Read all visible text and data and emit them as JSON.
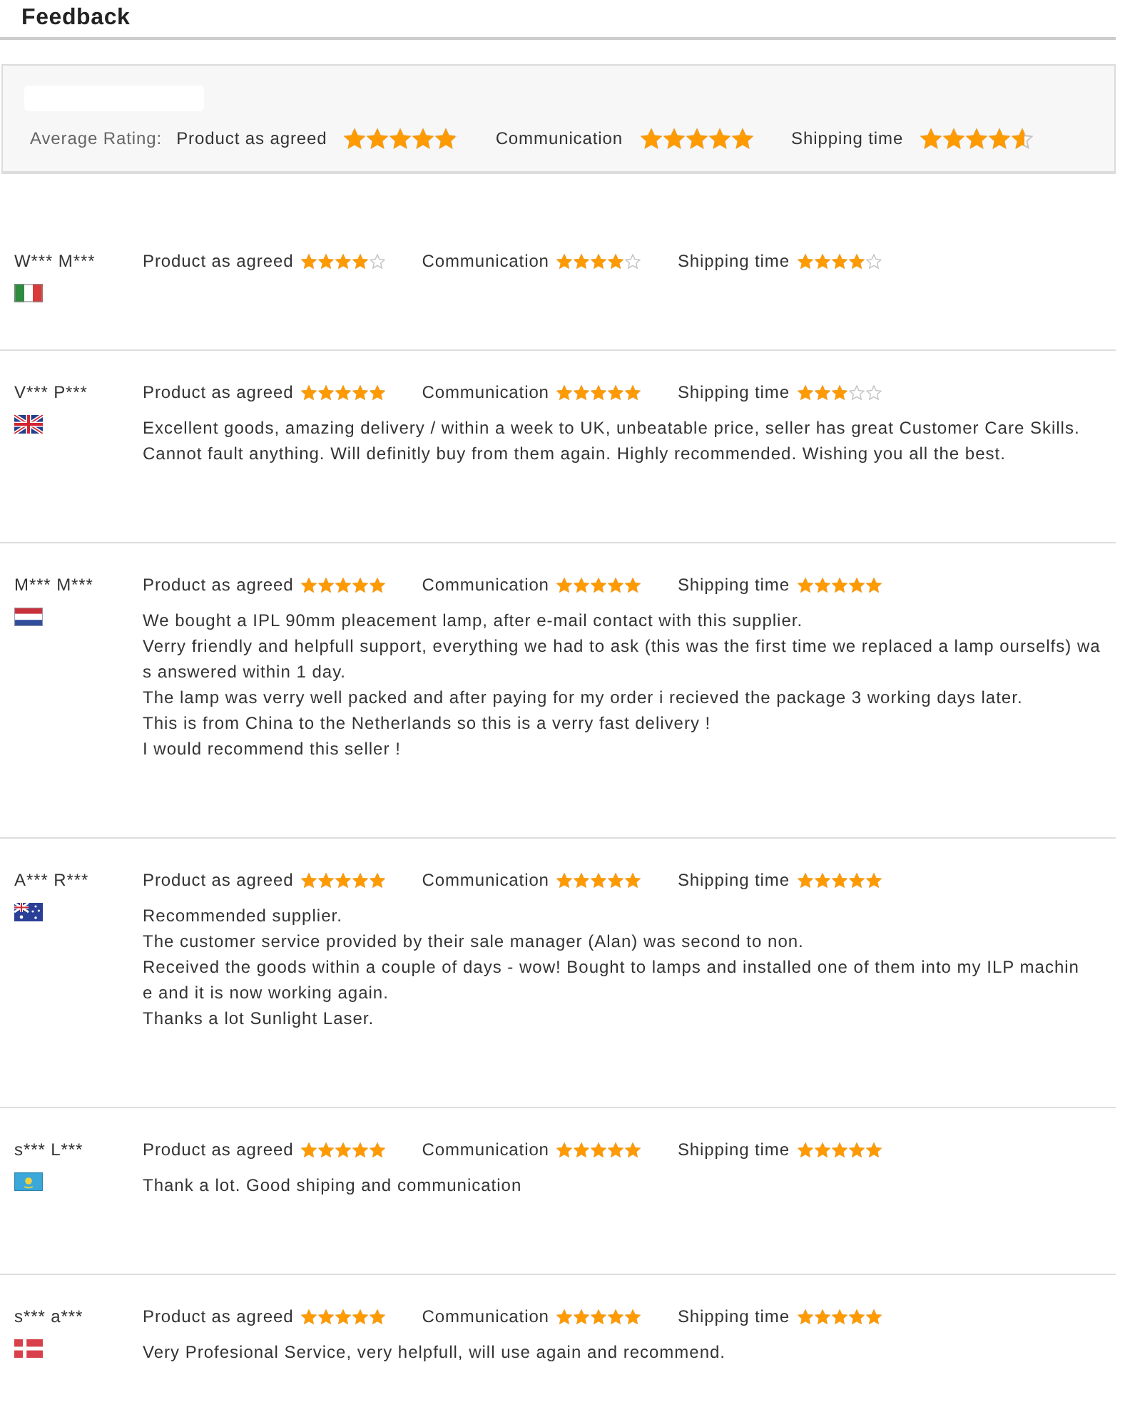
{
  "header": {
    "title": "Feedback"
  },
  "summary": {
    "label": "Average Rating:",
    "ratings": [
      {
        "label": "Product as agreed",
        "stars": 4.9
      },
      {
        "label": "Communication",
        "stars": 5
      },
      {
        "label": "Shipping time",
        "stars": 4.6
      }
    ]
  },
  "reviews": [
    {
      "name": "W*** M***",
      "flag": {
        "kind": "italy"
      },
      "ratings": [
        {
          "label": "Product as agreed",
          "stars": 4
        },
        {
          "label": "Communication",
          "stars": 4
        },
        {
          "label": "Shipping time",
          "stars": 4
        }
      ]
    },
    {
      "name": "V*** P***",
      "flag": {
        "kind": "uk"
      },
      "ratings": [
        {
          "label": "Product as agreed",
          "stars": 5
        },
        {
          "label": "Communication",
          "stars": 5
        },
        {
          "label": "Shipping time",
          "stars": 3
        }
      ],
      "comment": "Excellent goods, amazing delivery / within a week to UK, unbeatable price, seller has great Customer Care Skills.\nCannot fault anything. Will definitly buy from them again. Highly recommended. Wishing you all the best."
    },
    {
      "name": "M*** M***",
      "flag": {
        "kind": "netherlands"
      },
      "ratings": [
        {
          "label": "Product as agreed",
          "stars": 5
        },
        {
          "label": "Communication",
          "stars": 5
        },
        {
          "label": "Shipping time",
          "stars": 5
        }
      ],
      "comment": "We bought a IPL 90mm pleacement lamp, after e-mail contact with this supplier.\nVerry friendly and helpfull support, everything we had to ask (this was the first time we replaced a lamp ourselfs) wa\ns answered within 1 day.\nThe lamp was verry well packed and after paying for my order i recieved the package 3 working days later.\nThis is from China to the Netherlands so this is a verry fast delivery !\nI would recommend this seller !"
    },
    {
      "name": "A*** R***",
      "flag": {
        "kind": "australia"
      },
      "ratings": [
        {
          "label": "Product as agreed",
          "stars": 5
        },
        {
          "label": "Communication",
          "stars": 5
        },
        {
          "label": "Shipping time",
          "stars": 5
        }
      ],
      "comment": "Recommended supplier.\nThe customer service provided by their sale manager (Alan) was second to non.\nReceived the goods within a couple of days - wow! Bought to lamps and installed one of them into my ILP machin\ne and it is now working again.\nThanks a lot Sunlight Laser."
    },
    {
      "name": "s*** L***",
      "flag": {
        "kind": "kazakhstan"
      },
      "ratings": [
        {
          "label": "Product as agreed",
          "stars": 5
        },
        {
          "label": "Communication",
          "stars": 5
        },
        {
          "label": "Shipping time",
          "stars": 5
        }
      ],
      "comment": "Thank a lot. Good shiping and communication"
    },
    {
      "name": "s*** a***",
      "flag": {
        "kind": "denmark"
      },
      "ratings": [
        {
          "label": "Product as agreed",
          "stars": 5
        },
        {
          "label": "Communication",
          "stars": 5
        },
        {
          "label": "Shipping time",
          "stars": 5
        }
      ],
      "comment": "Very Profesional Service, very helpfull, will use again and recommend."
    }
  ]
}
